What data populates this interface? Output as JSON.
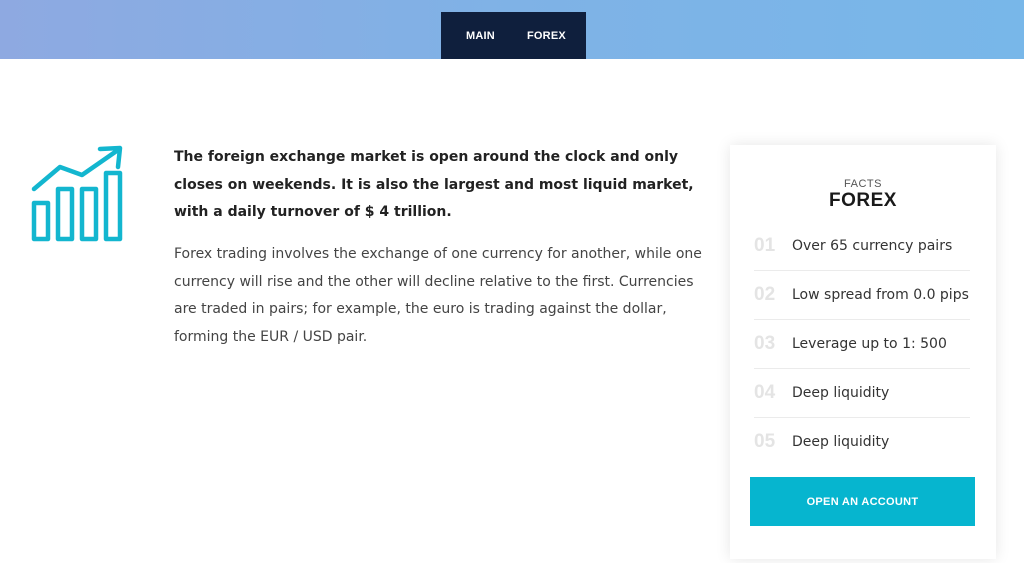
{
  "nav": {
    "main_label": "MAIN",
    "forex_label": "FOREX"
  },
  "content": {
    "lead": "The foreign exchange market is open around the clock and only closes on weekends. It is also the largest and most liquid market, with a daily turnover of $ 4 trillion.",
    "body": "Forex trading involves the exchange of one currency for another, while one currency will rise and the other will decline relative to the first. Currencies are traded in pairs; for example, the euro is trading against the dollar, forming the EUR / USD pair."
  },
  "facts": {
    "label": "FACTS",
    "title": "FOREX",
    "items": [
      {
        "num": "01",
        "text": "Over 65 currency pairs"
      },
      {
        "num": "02",
        "text": "Low spread from 0.0 pips"
      },
      {
        "num": "03",
        "text": "Leverage up to 1: 500"
      },
      {
        "num": "04",
        "text": "Deep liquidity"
      },
      {
        "num": "05",
        "text": "Deep liquidity"
      }
    ],
    "cta_label": "OPEN AN ACCOUNT"
  },
  "icons": {
    "chart": "growth-chart-icon"
  },
  "colors": {
    "accent": "#06b5cf",
    "nav_bg": "#0f1f3d",
    "header_gradient_start": "#8ea9e1",
    "header_gradient_end": "#78b7e9"
  }
}
